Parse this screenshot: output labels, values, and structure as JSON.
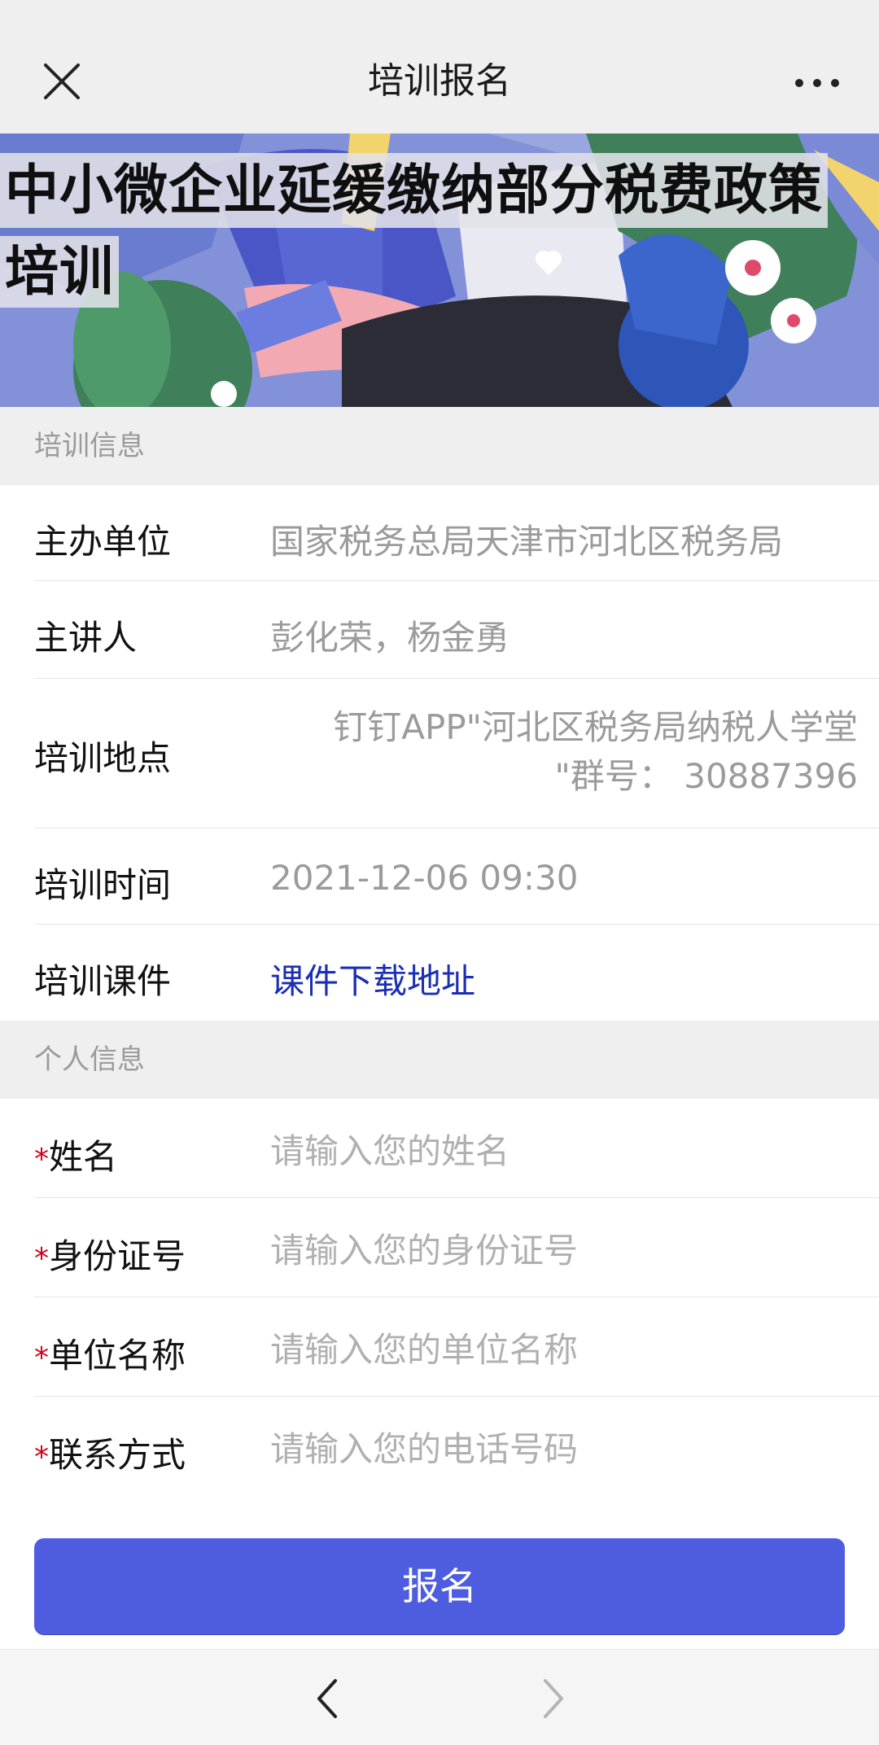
{
  "header": {
    "title": "培训报名",
    "close_icon": "close-icon",
    "more_icon": "more-horizontal-icon"
  },
  "banner": {
    "title_line1": "中小微企业延缓缴纳部分税费政策",
    "title_line2": "培训"
  },
  "training_info": {
    "section_title": "培训信息",
    "rows": [
      {
        "label": "主办单位",
        "value": "国家税务总局天津市河北区税务局"
      },
      {
        "label": "主讲人",
        "value": "彭化荣，杨金勇"
      },
      {
        "label": "培训地点",
        "value_line1": "钉钉APP\"河北区税务局纳税人学堂",
        "value_line2": "\"群号：  30887396"
      },
      {
        "label": "培训时间",
        "value": "2021-12-06 09:30"
      },
      {
        "label": "培训课件",
        "value": "课件下载地址"
      }
    ]
  },
  "personal_info": {
    "section_title": "个人信息",
    "required_mark": "*",
    "fields": [
      {
        "label": "姓名",
        "placeholder": "请输入您的姓名",
        "value": ""
      },
      {
        "label": "身份证号",
        "placeholder": "请输入您的身份证号",
        "value": ""
      },
      {
        "label": "单位名称",
        "placeholder": "请输入您的单位名称",
        "value": ""
      },
      {
        "label": "联系方式",
        "placeholder": "请输入您的电话号码",
        "value": ""
      }
    ]
  },
  "submit_label": "报名",
  "bottom_nav": {
    "back_icon": "chevron-left-icon",
    "forward_icon": "chevron-right-icon"
  },
  "colors": {
    "accent": "#4e5ddf",
    "link": "#1a2fb4",
    "required": "#d0021b",
    "section_bg": "#efefef"
  }
}
